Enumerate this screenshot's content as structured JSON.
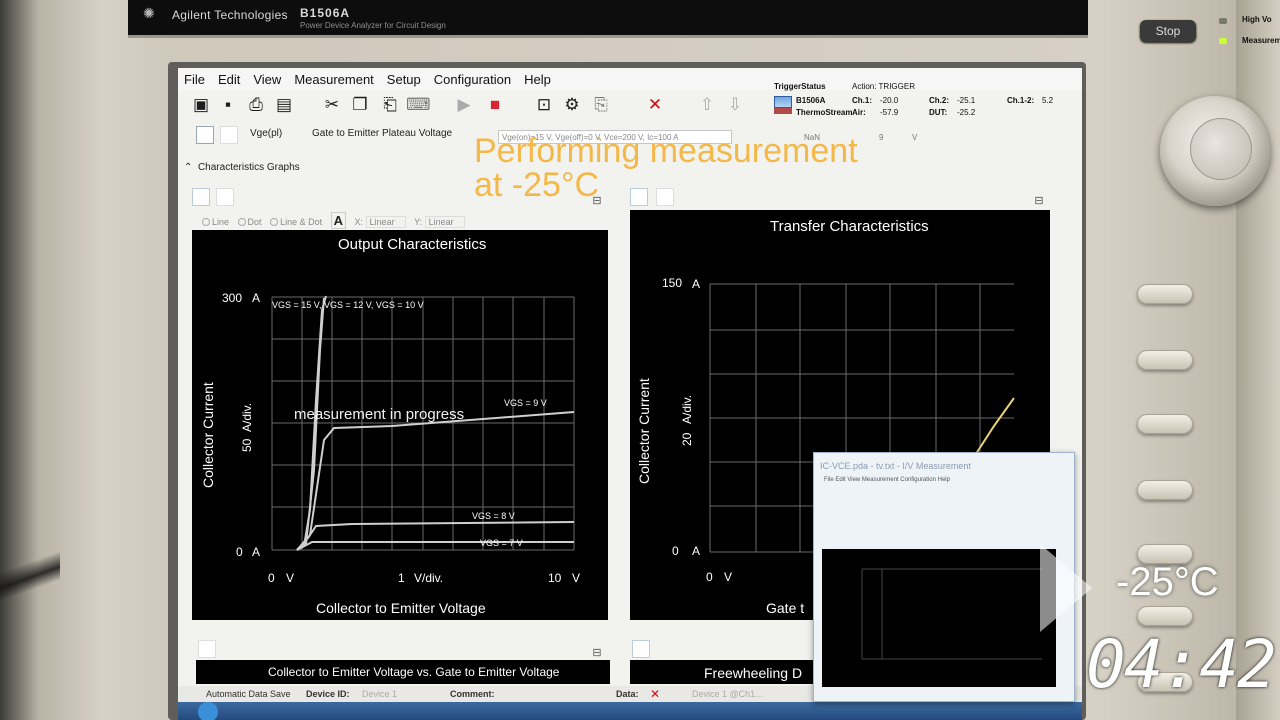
{
  "instrument": {
    "brand": "Agilent Technologies",
    "model": "B1506A",
    "model_subtitle": "Power Device Analyzer for Circuit Design",
    "stop_label": "Stop",
    "hv_label_1": "High Vo",
    "hv_label_2": "Measurem"
  },
  "menu": [
    "File",
    "Edit",
    "View",
    "Measurement",
    "Setup",
    "Configuration",
    "Help"
  ],
  "toolbar_icons": [
    "open-folder-icon",
    "save-icon",
    "print-icon",
    "export-icon",
    "cut-icon",
    "copy-icon",
    "paste-icon",
    "keyboard-icon",
    "play-icon",
    "stop-square-icon",
    "window-icon",
    "gear-icon",
    "clipboard-icon",
    "delete-x-icon",
    "up-arrow-icon",
    "down-arrow-icon"
  ],
  "status": {
    "trigger_status": "TriggerStatus",
    "action": "Action: TRIGGER",
    "device": "B1506A",
    "thermo": "ThermoStream",
    "ch1": "Ch.1:",
    "ch1_val": "-20.0",
    "ch2": "Ch.2:",
    "ch2_val": "-25.1",
    "ch12": "Ch.1-2:",
    "ch12_val": "5.2",
    "air": "Air:",
    "air_val": "-57.9",
    "dut": "DUT:",
    "dut_val": "-25.2"
  },
  "info": {
    "param": "Vge(pl)",
    "param_desc": "Gate to Emitter Plateau Voltage",
    "conditions": "Vge(on)=15 V, Vge(off)=0 V, Vce=200 V, Ic=100 A",
    "value": "NaN",
    "count": "9",
    "unit": "V"
  },
  "overlay": {
    "line1": "Performing measurement",
    "line2": "at -25°C"
  },
  "section_title": "Characteristics Graphs",
  "plot_options": {
    "line": "Line",
    "dot": "Dot",
    "line_dot": "Line & Dot",
    "font_btn": "A",
    "x_label": "X:",
    "x_val": "Linear",
    "y_label": "Y:",
    "y_val": "Linear"
  },
  "graph1": {
    "title": "Output Characteristics",
    "y_top": "300",
    "y_top_unit": "A",
    "y_zero": "0",
    "y_zero_unit": "A",
    "y_div": "50",
    "y_div_unit": "A/div.",
    "y_axis": "Collector Current",
    "x_zero": "0",
    "x_zero_unit": "V",
    "x_div": "1",
    "x_div_unit": "V/div.",
    "x_end": "10",
    "x_end_unit": "V",
    "x_axis": "Collector to Emitter Voltage",
    "progress": "measurement in progress",
    "lbl_vgs15": "VGS = 15 V, VGS = 12 V, VGS = 10 V",
    "lbl_vgs9": "VGS = 9 V",
    "lbl_vgs8": "VGS = 8 V",
    "lbl_vgs7": "VGS = 7 V"
  },
  "graph2": {
    "title": "Transfer Characteristics",
    "y_top": "150",
    "y_top_unit": "A",
    "y_zero": "0",
    "y_zero_unit": "A",
    "y_div": "20",
    "y_div_unit": "A/div.",
    "y_axis": "Collector Current",
    "x_zero": "0",
    "x_zero_unit": "V",
    "x_axis_partial": "Gate t"
  },
  "graph3": {
    "title": "Collector to Emitter Voltage vs. Gate to Emitter Voltage"
  },
  "graph4": {
    "title_partial": "Freewheeling D"
  },
  "statusbar": {
    "auto_save": "Automatic Data Save",
    "device_id": "Device ID:",
    "device_id_val": "Device 1",
    "comment": "Comment:",
    "data": "Data:",
    "data_val": "Device 1 @Ch1..."
  },
  "popup": {
    "title": "IC-VCE.pda - tv.txt - I/V Measurement",
    "menu": "File  Edit  View  Measurement  Configuration  Help"
  },
  "temperature": "-25°C",
  "timer": "04:42"
}
